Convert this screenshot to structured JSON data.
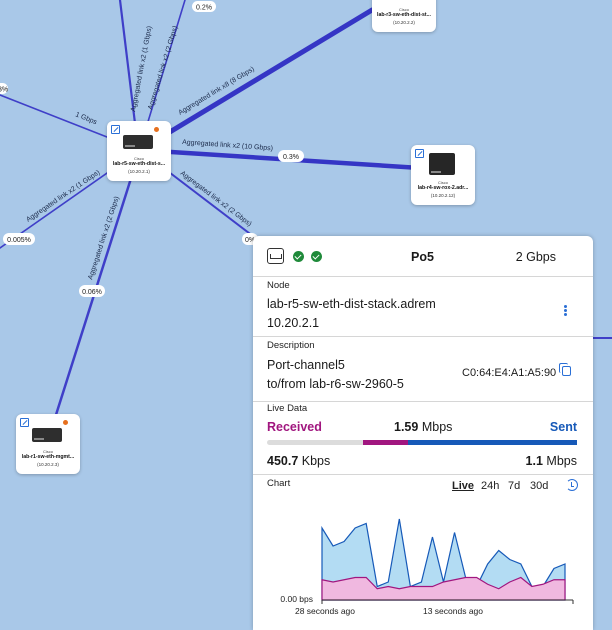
{
  "map": {
    "utilization_labels": [
      "0.2%",
      "3%",
      "0.3%",
      "0.005%",
      "0.06%",
      "0%"
    ],
    "link_labels": [
      "Aggregated link x2 (1 Gbps)",
      "Aggregated link x2 (2 Gbps)",
      "Aggregated link x8 (8 Gbps)",
      "1 Gbps",
      "Aggregated link x2 (10 Gbps)",
      "Aggregated link x2 (1 Gbps)",
      "Aggregated link x2 (2 Gbps)",
      "Aggregated link x2 (2 Gbps)"
    ],
    "nodes": [
      {
        "vendor": "Cisco",
        "name": "lab-r5-sw-eth-dist-s...",
        "ip": "(10.20.2.1)",
        "icon": "switch-icon"
      },
      {
        "vendor": "Cisco",
        "name": "lab-r4-sw-rox-2.adr...",
        "ip": "(10.20.2.12)",
        "icon": "switch-icon"
      },
      {
        "vendor": "Cisco",
        "name": "lab-r1-sw-eth-mgmt...",
        "ip": "(10.20.2.3)",
        "icon": "switch-icon"
      },
      {
        "vendor": "Cisco",
        "name": "lab-r3-sw-eth-dist-st...",
        "ip": "(10.20.2.2)",
        "icon": "switch-icon"
      }
    ]
  },
  "panel": {
    "title": "Po5",
    "speed": "2 Gbps",
    "node_label": "Node",
    "node_name": "lab-r5-sw-eth-dist-stack.adrem",
    "node_ip": "10.20.2.1",
    "description_label": "Description",
    "description_line1": "Port-channel5",
    "description_line2": "to/from lab-r6-sw-2960-5",
    "mac": "C0:64:E4:A1:A5:90",
    "live_data_label": "Live Data",
    "received_label": "Received",
    "sent_label": "Sent",
    "total_value": "1.59",
    "total_unit": "Mbps",
    "received_value": "450.7",
    "received_unit": "Kbps",
    "sent_value": "1.1",
    "sent_unit": "Mbps",
    "received_fraction": 0.28,
    "chart_label": "Chart",
    "tabs": [
      "Live",
      "24h",
      "7d",
      "30d"
    ],
    "active_tab": "Live",
    "colors": {
      "received": "#a1167f",
      "sent": "#1659b8",
      "link": "#3f3fc8"
    }
  },
  "chart_data": {
    "type": "area",
    "x_tick_labels": [
      "28 seconds ago",
      "13 seconds ago"
    ],
    "y_tick_labels": [
      "0.00 bps"
    ],
    "xlabel": "",
    "ylabel": "",
    "series": [
      {
        "values": [
          1.6,
          1.2,
          1.3,
          1.6,
          1.7,
          0.3,
          0.4,
          1.8,
          0.3,
          0.4,
          1.4,
          0.4,
          1.5,
          0.5,
          0.3,
          0.8,
          1.1,
          0.9,
          0.8,
          0.3,
          0.3,
          0.7,
          0.8
        ]
      },
      {
        "values": [
          0.45,
          0.4,
          0.45,
          0.5,
          0.5,
          0.25,
          0.3,
          0.25,
          0.3,
          0.3,
          0.3,
          0.4,
          0.45,
          0.5,
          0.5,
          0.35,
          0.25,
          0.4,
          0.5,
          0.3,
          0.35,
          0.45,
          0.45
        ]
      }
    ],
    "grid": false
  }
}
